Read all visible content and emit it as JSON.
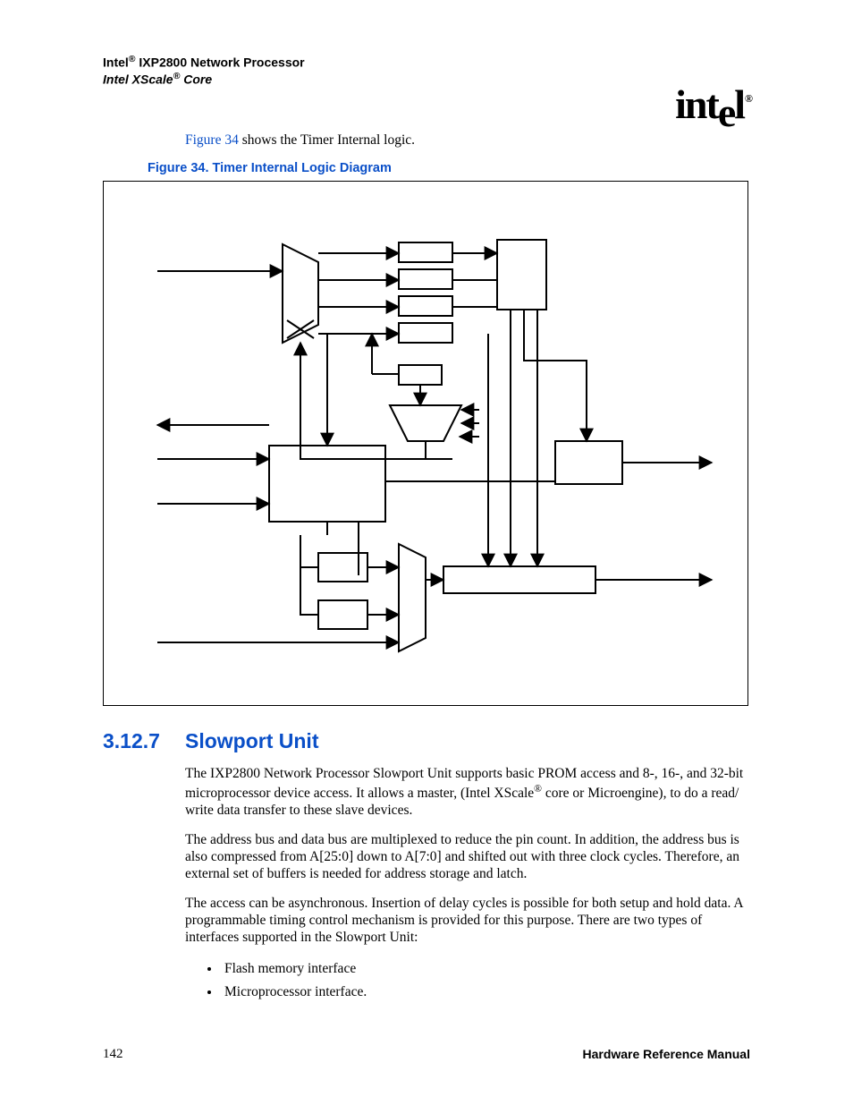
{
  "header": {
    "line1_prefix": "Intel",
    "line1_suffix": " IXP2800 Network Processor",
    "line2_prefix": "Intel XScale",
    "line2_suffix": " Core",
    "logo_text": "intel"
  },
  "intro": {
    "link_text": "Figure 34",
    "rest_text": " shows the Timer Internal logic."
  },
  "figure": {
    "caption": "Figure 34. Timer Internal Logic Diagram"
  },
  "section": {
    "number": "3.12.7",
    "title": "Slowport Unit",
    "p1a": "The IXP2800 Network Processor Slowport Unit supports basic PROM access and 8-, 16-, and 32-bit microprocessor device access. It allows a master, (Intel XScale",
    "p1b": " core or Microengine), to do a read/ write data transfer to these slave devices.",
    "p2": "The address bus and data bus are multiplexed to reduce the pin count. In addition, the address bus is also compressed from A[25:0] down to A[7:0] and shifted out with three clock cycles. Therefore, an external set of buffers is needed for address storage and latch.",
    "p3": "The access can be asynchronous. Insertion of delay cycles is possible for both setup and hold data. A programmable timing control mechanism is provided for this purpose. There are two types of interfaces supported in the Slowport Unit:",
    "bullets": [
      "Flash memory interface",
      "Microprocessor interface."
    ]
  },
  "footer": {
    "page_number": "142",
    "right_text": "Hardware Reference Manual"
  }
}
